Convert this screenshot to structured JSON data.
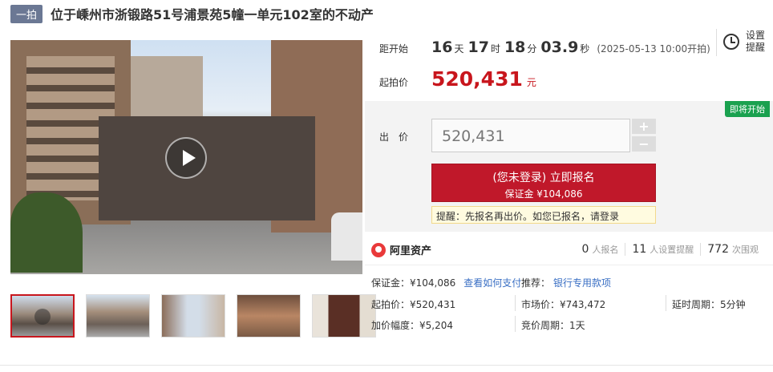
{
  "header": {
    "tag": "一拍",
    "title": "位于嵊州市浙锻路51号浦景苑5幢一单元102室的不动产"
  },
  "countdown": {
    "label": "距开始",
    "days": "16",
    "days_unit": "天",
    "hours": "17",
    "hours_unit": "时",
    "minutes": "18",
    "minutes_unit": "分",
    "seconds": "03.9",
    "seconds_unit": "秒",
    "start_note": "(2025-05-13 10:00开拍)"
  },
  "reminder": {
    "label": "设置提醒"
  },
  "start_price": {
    "label": "起拍价",
    "value": "520,431",
    "unit": "元"
  },
  "bid": {
    "status_badge": "即将开始",
    "label": "出　价",
    "input_value": "520,431",
    "plus": "+",
    "minus": "−",
    "signup_main": "(您未登录) 立即报名",
    "signup_sub": "保证金 ¥104,086",
    "hint": "提醒：先报名再出价。如您已报名，请登录"
  },
  "brand": {
    "name": "阿里资产"
  },
  "stats": [
    {
      "num": "0",
      "label": "人报名"
    },
    {
      "num": "11",
      "label": "人设置提醒"
    },
    {
      "num": "772",
      "label": "次围观"
    }
  ],
  "details": {
    "deposit": "保证金：¥104,086",
    "deposit_link": "查看如何支付",
    "recommend": "推荐：",
    "recommend_link": "银行专用款项",
    "start_price": "起拍价：¥520,431",
    "market_price": "市场价：¥743,472",
    "delay": "延时周期：5分钟",
    "increment": "加价幅度：¥5,204",
    "cycle": "竞价周期：1天"
  },
  "colors": {
    "accent": "#c8161d",
    "link": "#3a6fc4",
    "badge": "#1aa14f"
  }
}
